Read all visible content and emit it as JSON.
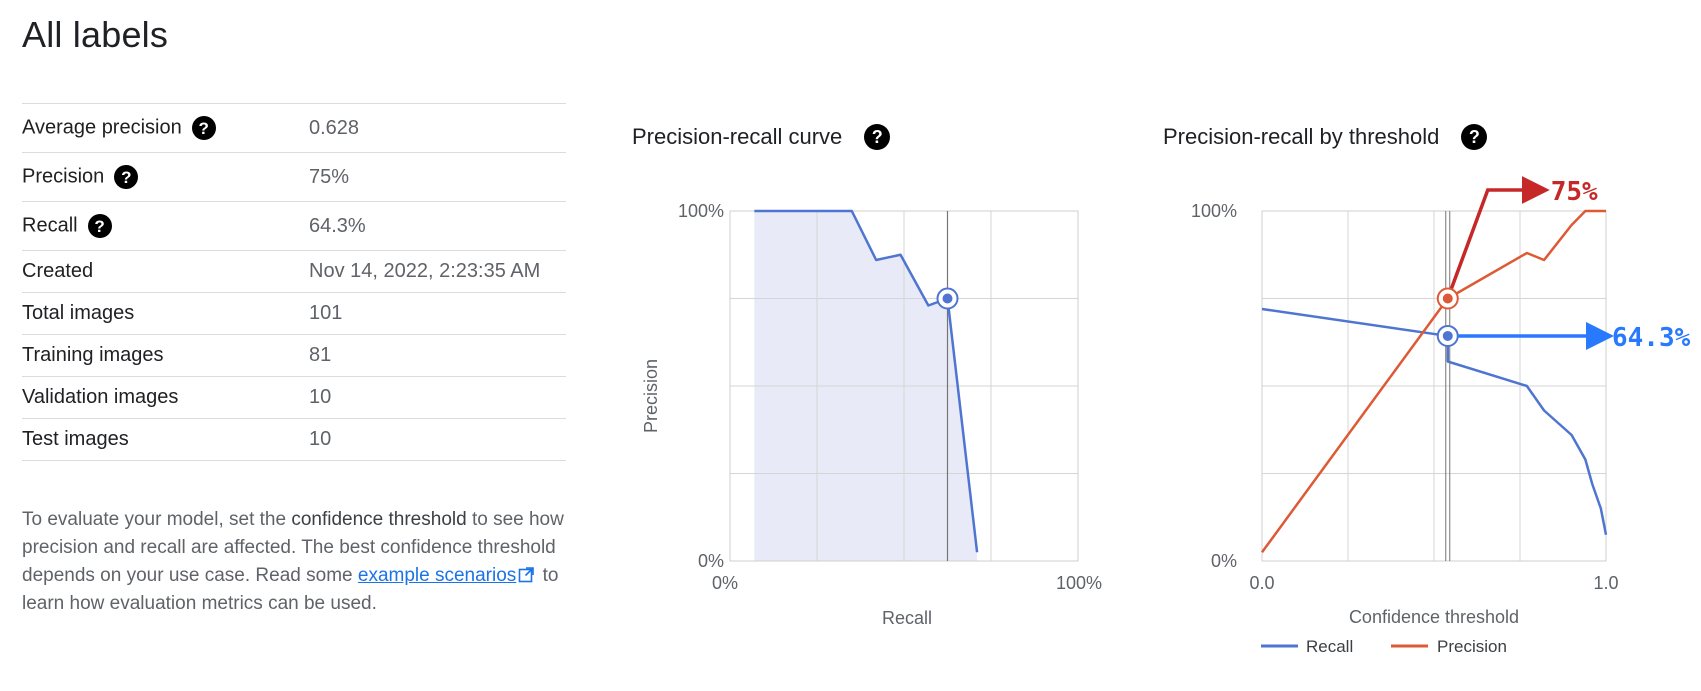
{
  "page": {
    "title": "All labels"
  },
  "metrics": [
    {
      "key": "Average precision",
      "value": "0.628",
      "help": true
    },
    {
      "key": "Precision",
      "value": "75%",
      "help": true
    },
    {
      "key": "Recall",
      "value": "64.3%",
      "help": true
    },
    {
      "key": "Created",
      "value": "Nov 14, 2022, 2:23:35 AM",
      "help": false
    },
    {
      "key": "Total images",
      "value": "101",
      "help": false
    },
    {
      "key": "Training images",
      "value": "81",
      "help": false
    },
    {
      "key": "Validation images",
      "value": "10",
      "help": false
    },
    {
      "key": "Test images",
      "value": "10",
      "help": false
    }
  ],
  "description": {
    "part1": "To evaluate your model, set the ",
    "bold": "confidence threshold",
    "part2": " to see how precision and recall are affected. The best confidence threshold depends on your use case. Read some ",
    "link": "example scenarios",
    "part3": " to learn how evaluation metrics can be used."
  },
  "help_glyph": "?",
  "chart_data": [
    {
      "type": "line",
      "title": "Precision-recall curve",
      "xlabel": "Recall",
      "ylabel": "Precision",
      "xlim": [
        0,
        100
      ],
      "ylim": [
        0,
        100
      ],
      "x_tick_labels": [
        "0%",
        "100%"
      ],
      "y_tick_labels": [
        "0%",
        "100%"
      ],
      "area_fill": true,
      "series": [
        {
          "color": "#4f75d1",
          "x": [
            7,
            35,
            42,
            49,
            57,
            62.5,
            62.5,
            71
          ],
          "y": [
            100,
            100,
            86,
            87.5,
            73,
            75,
            75,
            2.5
          ]
        }
      ],
      "marker": {
        "x": 62.5,
        "y": 75
      },
      "threshold_line_x": 62.5
    },
    {
      "type": "line",
      "title": "Precision-recall by threshold",
      "xlabel": "Confidence threshold",
      "xlim": [
        0,
        1
      ],
      "ylim": [
        0,
        100
      ],
      "x_tick_labels": [
        "0.0",
        "1.0"
      ],
      "y_tick_labels": [
        "0%",
        "100%"
      ],
      "series": [
        {
          "name": "Recall",
          "color": "#4f75d1",
          "x": [
            0.0,
            0.54,
            0.54,
            0.77,
            0.82,
            0.9,
            0.94,
            0.96,
            0.985,
            1.0
          ],
          "y": [
            72,
            64.3,
            57,
            50,
            43,
            36,
            29,
            22,
            15,
            7.5
          ]
        },
        {
          "name": "Precision",
          "color": "#dd5a35",
          "x": [
            0.0,
            0.54,
            0.77,
            0.82,
            0.9,
            0.94,
            1.0
          ],
          "y": [
            2.5,
            75,
            88,
            86,
            96,
            100,
            100
          ]
        }
      ],
      "threshold_line_x": 0.54,
      "markers": [
        {
          "x": 0.54,
          "y": 75,
          "color": "#dd5a35"
        },
        {
          "x": 0.54,
          "y": 64.3,
          "color": "#4f75d1"
        }
      ],
      "annotations": [
        {
          "text": "75%",
          "color": "#c62828"
        },
        {
          "text": "64.3%",
          "color": "#2979ff"
        }
      ]
    }
  ]
}
